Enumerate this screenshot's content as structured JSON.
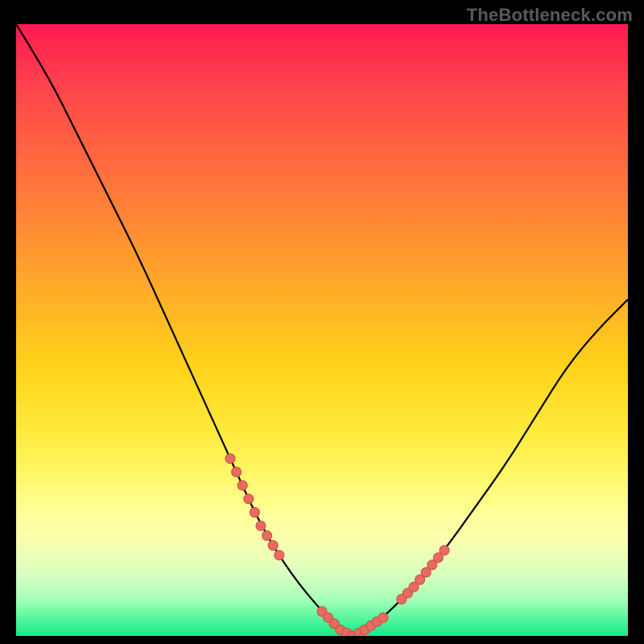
{
  "watermark": "TheBottleneck.com",
  "colors": {
    "curve_stroke": "#000000",
    "marker_fill": "#e86a60",
    "marker_stroke": "#c94d45",
    "gradient_top": "#ff1a52",
    "gradient_bottom": "#18e888"
  },
  "chart_data": {
    "type": "line",
    "title": "",
    "xlabel": "",
    "ylabel": "",
    "xlim": [
      0,
      100
    ],
    "ylim": [
      0,
      100
    ],
    "grid": false,
    "legend": false,
    "description": "Single V-shaped bottleneck curve plotted over a vertical heat gradient (red at top through yellow to green at bottom). The curve descends steeply from upper-left, reaches a minimum near x≈55 at the very bottom (green zone), then rises toward upper-right. Salmon-colored markers highlight a segment on the left descending branch, the flat bottom valley, and a segment on the right ascending branch.",
    "series": [
      {
        "name": "bottleneck-curve",
        "x": [
          0,
          5,
          10,
          15,
          20,
          25,
          30,
          35,
          40,
          45,
          50,
          53,
          55,
          57,
          60,
          65,
          70,
          75,
          80,
          85,
          90,
          95,
          100
        ],
        "y": [
          100,
          92,
          82,
          72,
          62,
          51,
          40,
          29,
          18,
          10,
          4,
          1,
          0,
          1,
          3,
          8,
          14,
          21,
          28,
          36,
          44,
          50,
          55
        ]
      }
    ],
    "markers": [
      {
        "name": "left-branch-markers",
        "x": [
          35,
          36,
          37,
          38,
          39,
          40,
          41,
          42,
          43
        ]
      },
      {
        "name": "valley-markers",
        "x": [
          50,
          51,
          52,
          53,
          54,
          55,
          56,
          57,
          58,
          59,
          60
        ]
      },
      {
        "name": "right-branch-markers",
        "x": [
          63,
          64,
          65,
          66,
          67,
          68,
          69,
          70
        ]
      }
    ]
  }
}
